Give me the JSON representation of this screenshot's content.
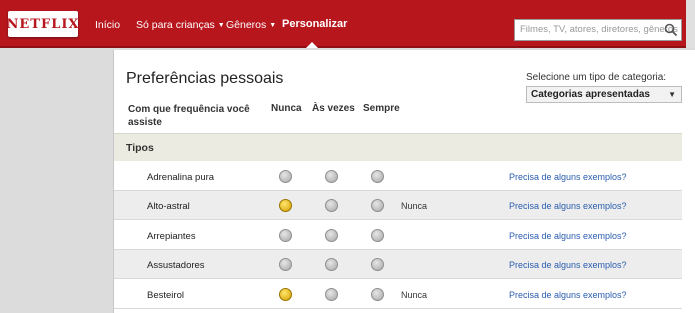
{
  "header": {
    "logo_text": "NETFLIX",
    "nav": [
      {
        "label": "Início"
      },
      {
        "label": "Só para crianças"
      },
      {
        "label": "Gêneros"
      },
      {
        "label": "Personalizar"
      }
    ],
    "search_placeholder": "Filmes, TV, atores, diretores, gêneros",
    "brand_color": "#b7161d"
  },
  "page": {
    "title": "Preferências pessoais",
    "category_label": "Selecione um tipo de categoria:",
    "category_selected": "Categorias apresentadas",
    "question_header": "Com que frequência você assiste",
    "options": [
      "Nunca",
      "Às vezes",
      "Sempre"
    ],
    "section_title": "Tipos",
    "example_link": "Precisa de alguns exemplos?",
    "rows": [
      {
        "label": "Adrenalina pura",
        "selected": "",
        "status": ""
      },
      {
        "label": "Alto-astral",
        "selected": "Nunca",
        "status": "Nunca"
      },
      {
        "label": "Arrepiantes",
        "selected": "",
        "status": ""
      },
      {
        "label": "Assustadores",
        "selected": "",
        "status": ""
      },
      {
        "label": "Besteirol",
        "selected": "Nunca",
        "status": "Nunca"
      }
    ]
  }
}
